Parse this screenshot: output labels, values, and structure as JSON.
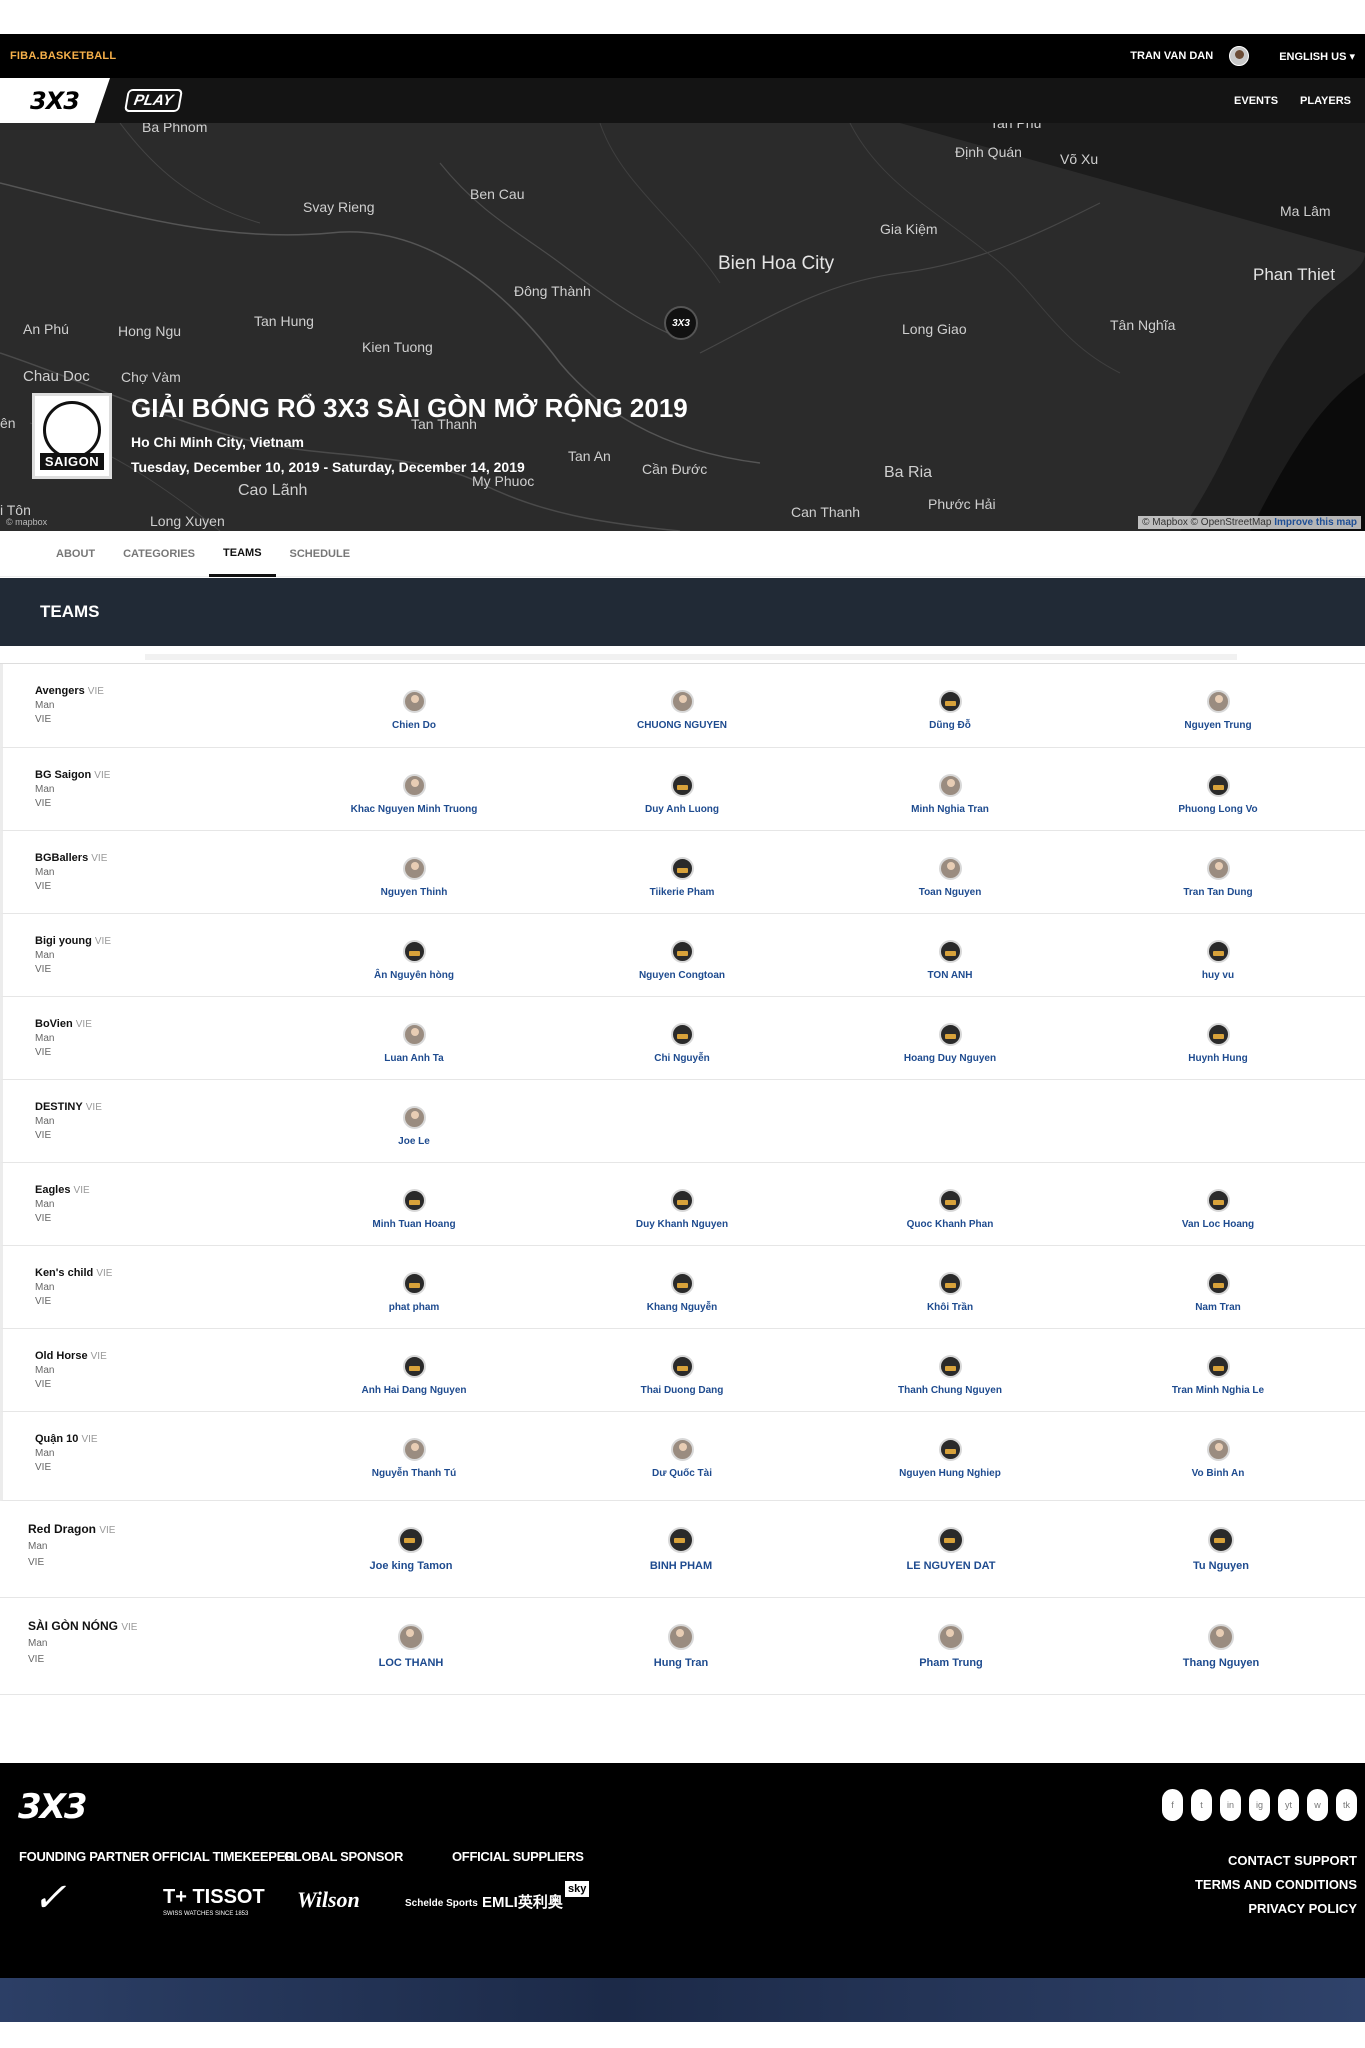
{
  "topbar": {
    "brand": "FIBA.BASKETBALL",
    "user": "TRAN VAN DAN",
    "language": "ENGLISH US ▾"
  },
  "nav": {
    "logo": "3X3",
    "play": "PLAY",
    "links": [
      "EVENTS",
      "PLAYERS"
    ]
  },
  "map": {
    "labels": [
      "Ba Phnom",
      "Svay Rieng",
      "Ben Cau",
      "Tan Phu",
      "Định Quán",
      "Võ Xu",
      "Ma Lâm",
      "Gia Kiệm",
      "Bien Hoa City",
      "Phan Thiet",
      "Đông Thành",
      "Tân Nghĩa",
      "An Phú",
      "Hong Ngu",
      "Tan Hung",
      "Long Giao",
      "Kien Tuong",
      "Chau Doc",
      "Chợ Vàm",
      "Tan Thanh",
      "Tan An",
      "Cần Đước",
      "My Phuoc",
      "Cao Lãnh",
      "Ba Ria",
      "Phước Hải",
      "Can Thanh",
      "Long Xuyen",
      "i Tôn",
      "ên"
    ],
    "attribution": "© Mapbox © OpenStreetMap",
    "improve": "Improve this map",
    "mapbox": "© mapbox"
  },
  "event": {
    "logo_text": "SAIGON",
    "title": "GIẢI BÓNG RỔ 3X3 SÀI GÒN MỞ RỘNG 2019",
    "location": "Ho Chi Minh City, Vietnam",
    "dates": "Tuesday, December 10, 2019 - Saturday, December 14, 2019"
  },
  "tabs": [
    "ABOUT",
    "CATEGORIES",
    "TEAMS",
    "SCHEDULE"
  ],
  "section_title": "TEAMS",
  "teams": [
    {
      "name": "Avengers",
      "country": "VIE",
      "gender": "Man",
      "origin": "VIE",
      "players": [
        "Chien Do",
        "CHUONG NGUYEN",
        "Dũng Đỗ",
        "Nguyen Trung"
      ]
    },
    {
      "name": "BG Saigon",
      "country": "VIE",
      "gender": "Man",
      "origin": "VIE",
      "players": [
        "Khac Nguyen Minh Truong",
        "Duy Anh Luong",
        "Minh Nghia Tran",
        "Phuong Long Vo"
      ]
    },
    {
      "name": "BGBallers",
      "country": "VIE",
      "gender": "Man",
      "origin": "VIE",
      "players": [
        "Nguyen Thinh",
        "Tiikerie Pham",
        "Toan Nguyen",
        "Tran Tan Dung"
      ]
    },
    {
      "name": "Bigi young",
      "country": "VIE",
      "gender": "Man",
      "origin": "VIE",
      "players": [
        "Ân Nguyên hòng",
        "Nguyen Congtoan",
        "TON ANH",
        "huy vu"
      ]
    },
    {
      "name": "BoVien",
      "country": "VIE",
      "gender": "Man",
      "origin": "VIE",
      "players": [
        "Luan Anh Ta",
        "Chi Nguyễn",
        "Hoang Duy Nguyen",
        "Huynh Hung"
      ]
    },
    {
      "name": "DESTINY",
      "country": "VIE",
      "gender": "Man",
      "origin": "VIE",
      "players": [
        "Joe Le"
      ]
    },
    {
      "name": "Eagles",
      "country": "VIE",
      "gender": "Man",
      "origin": "VIE",
      "players": [
        "Minh Tuan Hoang",
        "Duy Khanh Nguyen",
        "Quoc Khanh Phan",
        "Van Loc Hoang"
      ]
    },
    {
      "name": "Ken's child",
      "country": "VIE",
      "gender": "Man",
      "origin": "VIE",
      "players": [
        "phat pham",
        "Khang Nguyễn",
        "Khôi Trần",
        "Nam Tran"
      ]
    },
    {
      "name": "Old Horse",
      "country": "VIE",
      "gender": "Man",
      "origin": "VIE",
      "players": [
        "Anh Hai Dang Nguyen",
        "Thai Duong Dang",
        "Thanh Chung Nguyen",
        "Tran Minh Nghia Le"
      ]
    },
    {
      "name": "Quận 10",
      "country": "VIE",
      "gender": "Man",
      "origin": "VIE",
      "players": [
        "Nguyễn Thanh Tú",
        "Dư Quốc Tài",
        "Nguyen Hung Nghiep",
        "Vo Binh An"
      ]
    },
    {
      "name": "Red Dragon",
      "country": "VIE",
      "gender": "Man",
      "origin": "VIE",
      "players": [
        "Joe king Tamon",
        "BINH PHAM",
        "LE NGUYEN DAT",
        "Tu Nguyen"
      ]
    },
    {
      "name": "SÀI GÒN NÓNG",
      "country": "VIE",
      "gender": "Man",
      "origin": "VIE",
      "players": [
        "LOC THANH",
        "Hung Tran",
        "Pham Trung",
        "Thang Nguyen"
      ]
    }
  ],
  "footer": {
    "logo": "3X3",
    "socials": [
      "f",
      "t",
      "in",
      "ig",
      "yt",
      "w",
      "tk"
    ],
    "sponsor_labels": [
      "FOUNDING PARTNER",
      "OFFICIAL TIMEKEEPER",
      "GLOBAL SPONSOR",
      "OFFICIAL SUPPLIERS"
    ],
    "sponsors": [
      "✓",
      "T+ TISSOT",
      "SWISS WATCHES SINCE 1853",
      "Wilson",
      "Schelde Sports",
      "EMLI英利奥",
      "sky"
    ],
    "links": [
      "CONTACT SUPPORT",
      "TERMS AND CONDITIONS",
      "PRIVACY POLICY"
    ]
  },
  "colors": {
    "accent_link": "#1e4b8f",
    "header_dark": "#212a36",
    "brand_orange": "#f6b04a"
  }
}
